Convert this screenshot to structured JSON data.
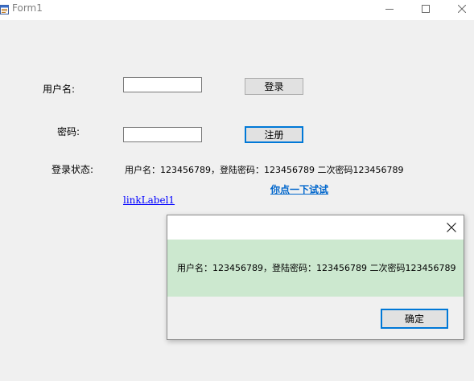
{
  "window": {
    "title": "Form1",
    "icon": "app-form-icon",
    "controls": [
      "minimize-icon",
      "maximize-icon",
      "close-icon"
    ]
  },
  "form": {
    "username_label": "用户名:",
    "password_label": "密码:",
    "status_label": "登录状态:",
    "username_value": "",
    "password_value": "",
    "login_button": "登录",
    "register_button": "注册",
    "status_text": "用户名：123456789，登陆密码：123456789 二次密码123456789",
    "try_link": "你点一下试试",
    "link_label": "linkLabel1"
  },
  "message_box": {
    "message": "用户名：123456789，登陆密码：123456789 二次密码123456789",
    "ok_button": "确定"
  },
  "colors": {
    "form_background": "#f0f0f0",
    "message_body_background": "#cce8cf",
    "focus_border": "#0078d7",
    "link": "#0066cc"
  }
}
